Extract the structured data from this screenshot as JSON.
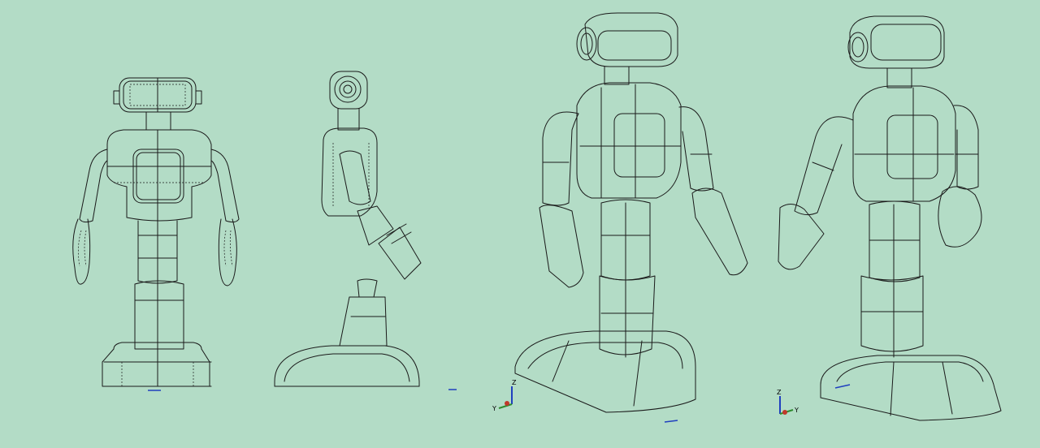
{
  "scene": {
    "background": "#b3dcc6",
    "line_color": "#1a1a1a",
    "views": [
      {
        "name": "front-view"
      },
      {
        "name": "side-view"
      },
      {
        "name": "iso-view-left"
      },
      {
        "name": "iso-view-right"
      }
    ]
  },
  "axes": {
    "x_color": "#c0392b",
    "y_color": "#2e8b2e",
    "z_color": "#1f3fbf",
    "triad_left": {
      "z": "Z",
      "y": "Y"
    },
    "triad_right": {
      "z": "Z",
      "y": "Y"
    }
  }
}
